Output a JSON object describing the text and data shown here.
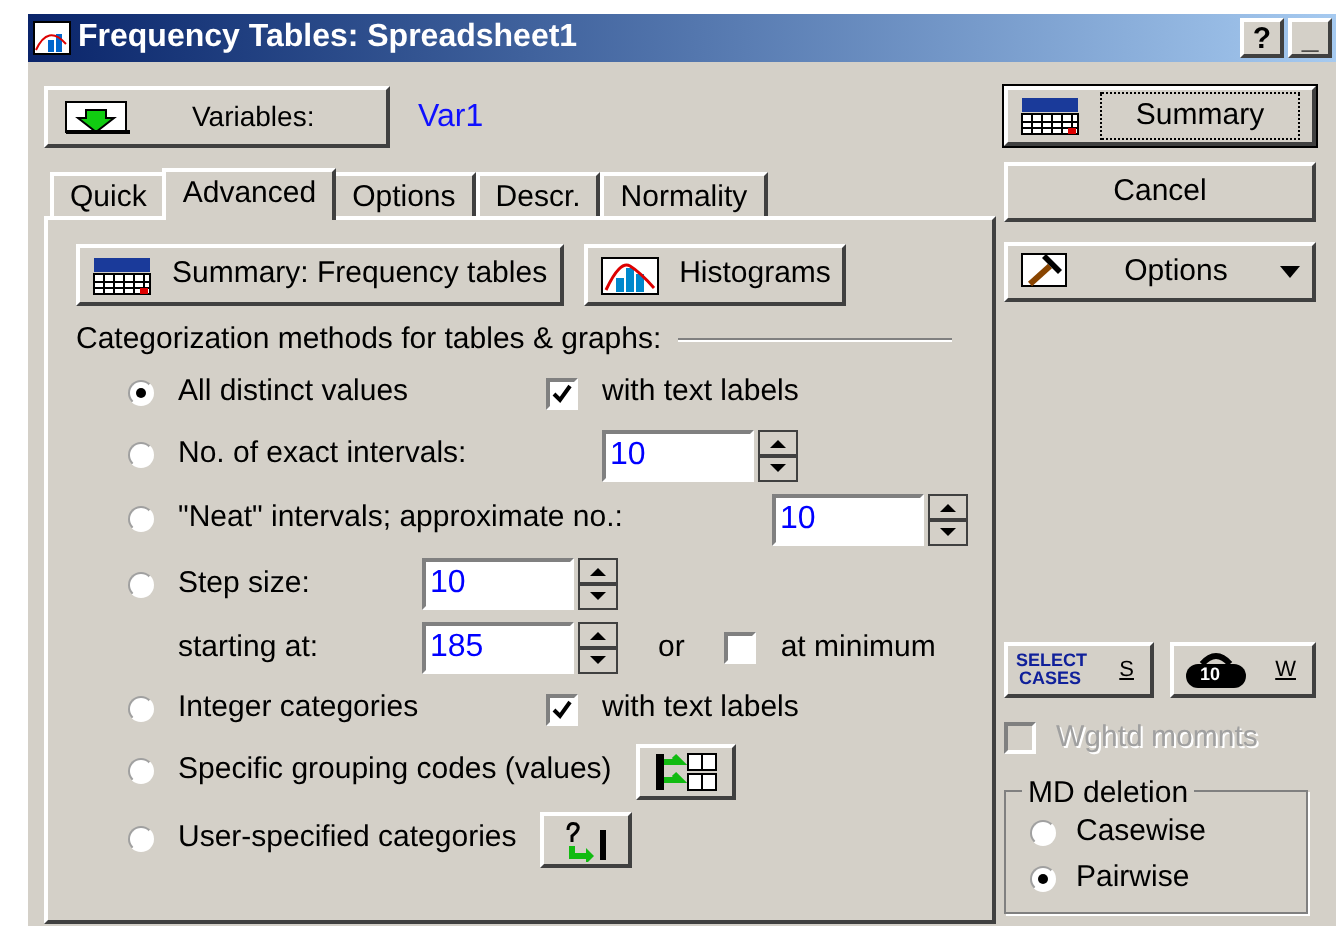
{
  "window": {
    "title": "Frequency Tables: Spreadsheet1",
    "title_buttons": [
      "?",
      "_"
    ]
  },
  "variables": {
    "button": "Variables:",
    "value": "Var1"
  },
  "tabs": [
    {
      "label": "Quick",
      "selected": false
    },
    {
      "label": "Advanced",
      "selected": true
    },
    {
      "label": "Options",
      "selected": false
    },
    {
      "label": "Descr.",
      "selected": false
    },
    {
      "label": "Normality",
      "selected": false
    }
  ],
  "actions": [
    {
      "label": "Summary:  Frequency tables"
    },
    {
      "label": "Histograms"
    }
  ],
  "group_label": "Categorization methods for tables & graphs:",
  "methods": [
    {
      "kind": "radio",
      "label": "All distinct values",
      "selected": true,
      "checkbox": {
        "label": "with text labels",
        "checked": true
      }
    },
    {
      "kind": "radio",
      "label": "No. of exact intervals:",
      "selected": false,
      "spin": "10"
    },
    {
      "kind": "radio",
      "label": "\"Neat\" intervals; approximate no.:",
      "selected": false,
      "spin": "10"
    },
    {
      "kind": "radio",
      "label": "Step size:",
      "selected": false,
      "spin": "10"
    },
    {
      "kind": "sub",
      "label": "starting at:",
      "spin": "185",
      "joiner": "or",
      "checkbox": {
        "label": "at minimum",
        "checked": false
      }
    },
    {
      "kind": "radio",
      "label": "Integer categories",
      "selected": false,
      "checkbox": {
        "label": "with text labels",
        "checked": true
      }
    },
    {
      "kind": "radio_with_button",
      "label": "Specific grouping codes (values)",
      "selected": false
    },
    {
      "kind": "radio_with_button",
      "label": "User-specified categories",
      "selected": false
    }
  ],
  "side_buttons": [
    {
      "label": "Summary",
      "default": true
    },
    {
      "label": "Cancel",
      "default": false
    },
    {
      "label": "Options",
      "default": false,
      "dropdown": true
    }
  ],
  "select_cases": {
    "icon_text": "SELECT CASES",
    "key": "S"
  },
  "weight": {
    "icon_text": "10",
    "key": "W"
  },
  "weighted_moments": {
    "label": "Wghtd momnts",
    "checked": false,
    "disabled": true
  },
  "md_deletion": {
    "title": "MD deletion",
    "options": [
      {
        "label": "Casewise",
        "selected": false
      },
      {
        "label": "Pairwise",
        "selected": true
      }
    ]
  }
}
